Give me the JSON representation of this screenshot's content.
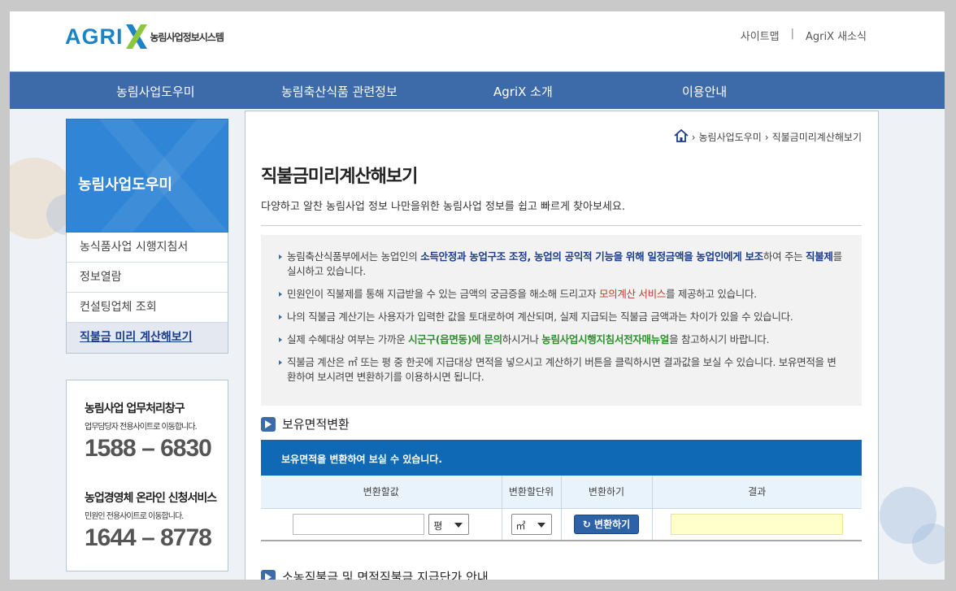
{
  "header": {
    "logo_text": "AGRI",
    "logo_tagline": "농림사업정보시스템",
    "util_links": [
      "사이트맵",
      "AgriX 새소식"
    ],
    "util_sep": "|"
  },
  "gnb": {
    "items": [
      "농림사업도우미",
      "농림축산식품 관련정보",
      "AgriX 소개",
      "이용안내"
    ]
  },
  "lnb": {
    "title": "농림사업도우미",
    "items": [
      "농식품사업 시행지침서",
      "정보열람",
      "컨설팅업체 조회",
      "직불금 미리 계산해보기"
    ]
  },
  "banners": [
    {
      "title": "농림사업 업무처리창구",
      "sub": "업무담당자 전용사이트로 이동합니다.",
      "phone": "1588 – 6830"
    },
    {
      "title": "농업경영체 온라인 신청서비스",
      "sub": "민원인 전용사이트로 이동합니다.",
      "phone": "1644 – 8778"
    }
  ],
  "breadcrumb": {
    "items": [
      "농림사업도우미",
      "직불금미리계산해보기"
    ]
  },
  "page": {
    "title": "직불금미리계산해보기",
    "subtitle": "다양하고 알찬 농림사업 정보 나만을위한 농림사업 정보를 쉽고 빠르게 찾아보세요."
  },
  "notice": {
    "n1_a": "농림축산식품부에서는 농업인의 ",
    "n1_b": "소득안정과 농업구조 조정, 농업의 공익적 기능을 위해 일정금액을 농업인에게 보조",
    "n1_c": "하여 주는 ",
    "n1_d": "직불제",
    "n1_e": "를 실시하고 있습니다.",
    "n2_a": "민원인이 직불제를 통해 지급받을 수 있는 금액의 궁금증을 해소해 드리고자 ",
    "n2_b": "모의계산 서비스",
    "n2_c": "를 제공하고 있습니다.",
    "n3": "나의 직불금 계산기는 사용자가 입력한 값을 토대로하여 계산되며, 실제 지급되는 직불금 금액과는 차이가 있을 수 있습니다.",
    "n4_a": "실제 수혜대상 여부는 가까운 ",
    "n4_b": "시군구(읍면동)에 문의",
    "n4_c": "하시거나 ",
    "n4_d": "농림사업시행지침서전자매뉴얼",
    "n4_e": "을 참고하시기 바랍니다.",
    "n5": "직불금 계산은 ㎡ 또는 평 중 한곳에 지급대상 면적을 넣으시고 계산하기 버튼을 클릭하시면 결과값을 보실 수 있습니다. 보유면적을 변환하여 보시려면 변환하기를 이용하시면 됩니다."
  },
  "section1": {
    "title": "보유면적변환",
    "bar_text": "보유면적을 변환하여 보실 수 있습니다."
  },
  "convert_table": {
    "headers": [
      "변환할값",
      "변환할단위",
      "변환하기",
      "결과"
    ],
    "unit_from": "평",
    "unit_to": "㎡",
    "button_label": "변환하기",
    "input_value": "",
    "result_value": ""
  },
  "section2": {
    "title": "소농직불금 및 면적직불금 지급단가 안내"
  }
}
